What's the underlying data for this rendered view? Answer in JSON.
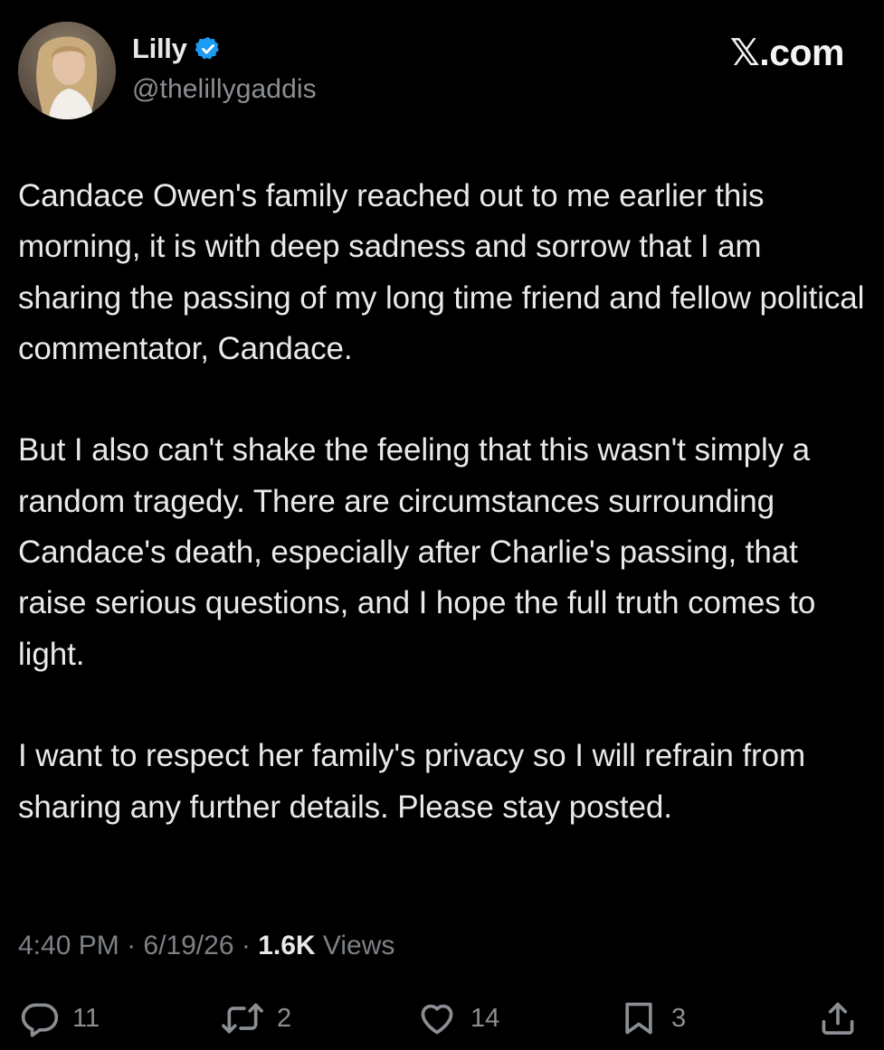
{
  "tweet": {
    "author": {
      "display_name": "Lilly",
      "handle": "@thelillygaddis",
      "verified": true
    },
    "brand": "𝕏.com",
    "paragraphs": [
      "Candace Owen's family reached out to me earlier this morning, it is with deep sadness and sorrow that I am sharing the passing of my long time friend and fellow political commentator, Candace.",
      "But I also can't shake the feeling that this wasn't simply a random tragedy. There are circumstances surrounding Candace's death, especially after Charlie's passing, that raise serious questions, and I hope the full truth comes to light.",
      "I want to respect her family's privacy so I will refrain from sharing any further details. Please stay posted."
    ],
    "meta": {
      "time": "4:40 PM",
      "separator": "·",
      "date": "6/19/26",
      "views_count": "1.6K",
      "views_label": "Views"
    },
    "actions": {
      "replies": "11",
      "reposts": "2",
      "likes": "14",
      "bookmarks": "3"
    }
  },
  "colors": {
    "background": "#000000",
    "text": "#e7e9ea",
    "secondary": "#8b8f93",
    "verified": "#1d9bf0"
  },
  "icons": {
    "verified": "verified-badge-icon",
    "reply": "speech-bubble-icon",
    "repost": "repost-arrows-icon",
    "like": "heart-icon",
    "bookmark": "bookmark-icon",
    "share": "share-upload-icon"
  }
}
